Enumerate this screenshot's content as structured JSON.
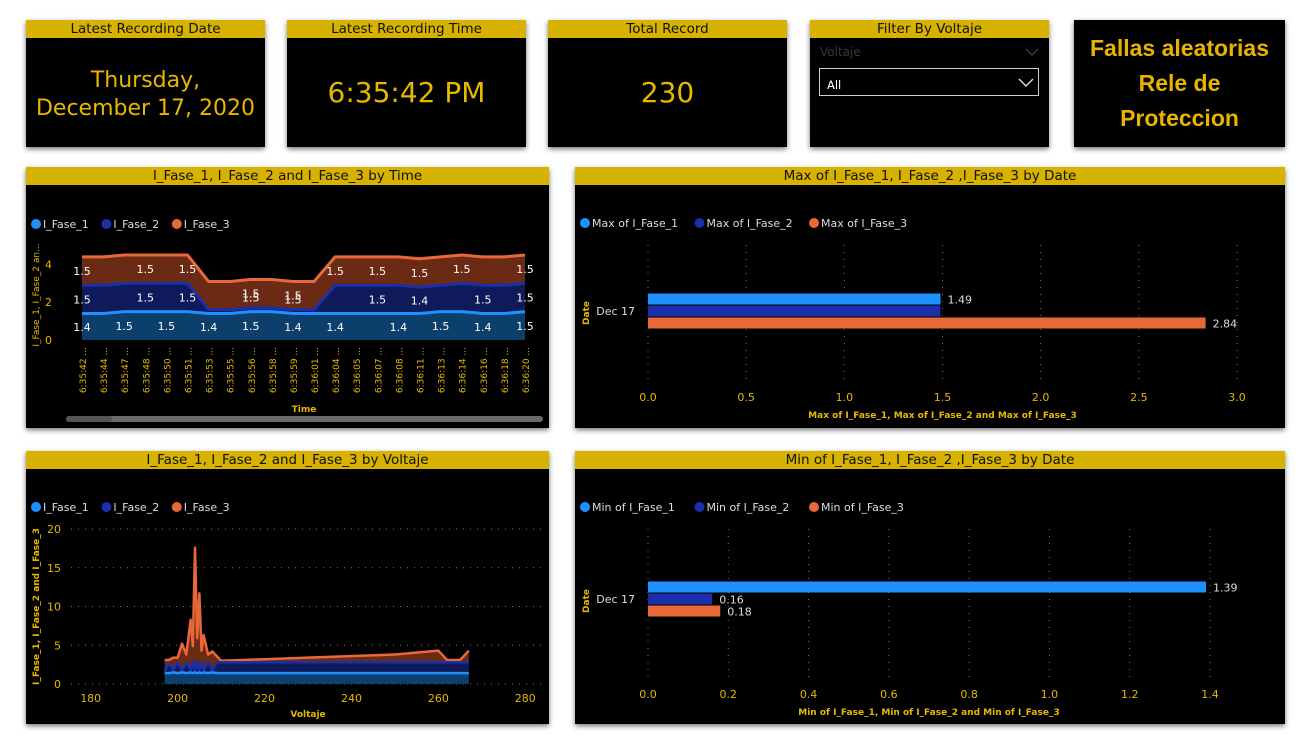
{
  "cards": {
    "date": {
      "title": "Latest Recording Date",
      "line1": "Thursday,",
      "line2": "December 17, 2020"
    },
    "time": {
      "title": "Latest Recording Time",
      "value": "6:35:42 PM"
    },
    "total": {
      "title": "Total Record",
      "value": "230"
    },
    "filter": {
      "title": "Filter By Voltaje",
      "label": "Voltaje",
      "selected": "All"
    },
    "brand": {
      "line1": "Fallas aleatorias",
      "line2": "Rele de",
      "line3": "Proteccion"
    }
  },
  "colors": {
    "header": "#d8b200",
    "accent": "#e6b800",
    "fase1": "#1e90ff",
    "fase2": "#1a2fa8",
    "fase3": "#e8683a",
    "band1": "#0c3f6b",
    "band2": "#0f1a5a",
    "band3": "#6b2a14"
  },
  "chart_data": [
    {
      "type": "area",
      "title": "I_Fase_1, I_Fase_2 and I_Fase_3 by Time",
      "xlabel": "Time",
      "ylabel": "I_Fase_1, I_Fase_2 an...",
      "legend": [
        "I_Fase_1",
        "I_Fase_2",
        "I_Fase_3"
      ],
      "legend_position": "top-left",
      "stacked": true,
      "grid": false,
      "ylim": [
        0,
        4.5
      ],
      "yticks": [
        0,
        2,
        4
      ],
      "x": [
        "6:35:42 ...",
        "6:35:44 ...",
        "6:35:47 ...",
        "6:35:48 ...",
        "6:35:50 ...",
        "6:35:51 ...",
        "6:35:53 ...",
        "6:35:55 ...",
        "6:35:56 ...",
        "6:35:58 ...",
        "6:35:59 ...",
        "6:36:01 ...",
        "6:36:04 ...",
        "6:36:05 ...",
        "6:36:07 ...",
        "6:36:08 ...",
        "6:36:11 ...",
        "6:36:13 ...",
        "6:36:14 ...",
        "6:36:16 ...",
        "6:36:18 ...",
        "6:36:20 ..."
      ],
      "series": [
        {
          "name": "I_Fase_1",
          "values": [
            1.4,
            1.4,
            1.5,
            1.5,
            1.5,
            1.5,
            1.4,
            1.4,
            1.5,
            1.5,
            1.4,
            1.4,
            1.4,
            1.4,
            1.4,
            1.4,
            1.4,
            1.5,
            1.5,
            1.4,
            1.4,
            1.5
          ]
        },
        {
          "name": "I_Fase_2",
          "values": [
            1.5,
            1.5,
            1.5,
            1.5,
            1.5,
            1.5,
            0.2,
            0.2,
            0.2,
            0.2,
            0.2,
            0.2,
            1.5,
            1.5,
            1.5,
            1.5,
            1.4,
            1.4,
            1.5,
            1.5,
            1.5,
            1.5
          ]
        },
        {
          "name": "I_Fase_3",
          "values": [
            1.5,
            1.5,
            1.5,
            1.5,
            1.5,
            1.5,
            1.5,
            1.5,
            1.5,
            1.5,
            1.5,
            1.5,
            1.5,
            1.5,
            1.5,
            1.5,
            1.5,
            1.5,
            1.5,
            1.5,
            1.5,
            1.5
          ]
        }
      ],
      "data_labels": [
        {
          "series": 2,
          "index": 0,
          "text": "1.5"
        },
        {
          "series": 2,
          "index": 3,
          "text": "1.5"
        },
        {
          "series": 2,
          "index": 5,
          "text": "1.5"
        },
        {
          "series": 2,
          "index": 8,
          "text": "1.5"
        },
        {
          "series": 2,
          "index": 10,
          "text": "1.5"
        },
        {
          "series": 2,
          "index": 12,
          "text": "1.5"
        },
        {
          "series": 2,
          "index": 14,
          "text": "1.5"
        },
        {
          "series": 2,
          "index": 16,
          "text": "1.5"
        },
        {
          "series": 2,
          "index": 18,
          "text": "1.5"
        },
        {
          "series": 2,
          "index": 21,
          "text": "1.5"
        },
        {
          "series": 1,
          "index": 0,
          "text": "1.5"
        },
        {
          "series": 1,
          "index": 3,
          "text": "1.5"
        },
        {
          "series": 1,
          "index": 5,
          "text": "1.5"
        },
        {
          "series": 1,
          "index": 14,
          "text": "1.5"
        },
        {
          "series": 1,
          "index": 16,
          "text": "1.4"
        },
        {
          "series": 1,
          "index": 19,
          "text": "1.5"
        },
        {
          "series": 1,
          "index": 21,
          "text": "1.5"
        },
        {
          "series": 0,
          "index": 0,
          "text": "1.4"
        },
        {
          "series": 0,
          "index": 2,
          "text": "1.5"
        },
        {
          "series": 0,
          "index": 4,
          "text": "1.5"
        },
        {
          "series": 0,
          "index": 6,
          "text": "1.4"
        },
        {
          "series": 0,
          "index": 8,
          "text": "1.5"
        },
        {
          "series": 0,
          "index": 10,
          "text": "1.4"
        },
        {
          "series": 0,
          "index": 12,
          "text": "1.4"
        },
        {
          "series": 0,
          "index": 15,
          "text": "1.4"
        },
        {
          "series": 0,
          "index": 17,
          "text": "1.5"
        },
        {
          "series": 0,
          "index": 19,
          "text": "1.4"
        },
        {
          "series": 0,
          "index": 21,
          "text": "1.5"
        }
      ],
      "mid_labels": [
        {
          "index": 8,
          "text": "1.5"
        },
        {
          "index": 10,
          "text": "1.5"
        }
      ]
    },
    {
      "type": "bar",
      "orientation": "horizontal",
      "title": "Max of I_Fase_1, I_Fase_2 ,I_Fase_3 by Date",
      "xlabel": "Max of I_Fase_1, Max of I_Fase_2 and Max of I_Fase_3",
      "ylabel": "Date",
      "legend": [
        "Max of I_Fase_1",
        "Max of I_Fase_2",
        "Max of I_Fase_3"
      ],
      "legend_position": "top-left",
      "categories": [
        "Dec 17"
      ],
      "xlim": [
        0,
        3.0
      ],
      "xticks": [
        "0.0",
        "0.5",
        "1.0",
        "1.5",
        "2.0",
        "2.5",
        "3.0"
      ],
      "series": [
        {
          "name": "Max of I_Fase_1",
          "values": [
            1.49
          ],
          "label": "1.49"
        },
        {
          "name": "Max of I_Fase_2",
          "values": [
            1.49
          ],
          "label": ""
        },
        {
          "name": "Max of I_Fase_3",
          "values": [
            2.84
          ],
          "label": "2.84"
        }
      ]
    },
    {
      "type": "area",
      "title": "I_Fase_1, I_Fase_2 and I_Fase_3 by Voltaje",
      "xlabel": "Voltaje",
      "ylabel": "I_Fase_1, I_Fase_2 and I_Fase_3",
      "legend": [
        "I_Fase_1",
        "I_Fase_2",
        "I_Fase_3"
      ],
      "legend_position": "top-left",
      "stacked": true,
      "xlim": [
        178,
        282
      ],
      "xticks": [
        180,
        200,
        220,
        240,
        260,
        280
      ],
      "ylim": [
        0,
        20
      ],
      "yticks": [
        0,
        5,
        10,
        15,
        20
      ],
      "x": [
        197,
        198,
        199,
        200,
        201,
        202,
        203,
        203.5,
        204,
        204.5,
        205,
        205.5,
        206,
        207,
        208,
        209,
        210,
        215,
        230,
        250,
        260,
        262,
        263,
        265,
        267
      ],
      "series": [
        {
          "name": "I_Fase_1",
          "values": [
            1.4,
            1.4,
            1.5,
            1.4,
            1.5,
            1.4,
            1.5,
            1.4,
            1.5,
            1.4,
            1.5,
            1.4,
            1.5,
            1.4,
            1.5,
            1.4,
            1.4,
            1.4,
            1.4,
            1.4,
            1.4,
            1.4,
            1.4,
            1.4,
            1.4
          ]
        },
        {
          "name": "I_Fase_2",
          "values": [
            0.2,
            1.3,
            0.3,
            1.4,
            0.2,
            1.4,
            0.3,
            1.5,
            0.2,
            1.5,
            0.2,
            1.4,
            0.3,
            1.4,
            0.2,
            1.4,
            1.4,
            1.4,
            1.4,
            1.4,
            1.4,
            1.4,
            1.4,
            1.4,
            1.4
          ]
        },
        {
          "name": "I_Fase_3",
          "values": [
            1.5,
            0.4,
            1.6,
            0.6,
            3.5,
            1.0,
            6.5,
            2.0,
            15.9,
            3.0,
            10.0,
            1.5,
            4.5,
            1.0,
            2.5,
            0.8,
            0.2,
            0.3,
            0.6,
            1.0,
            1.5,
            0.3,
            0.3,
            0.3,
            1.5
          ]
        }
      ]
    },
    {
      "type": "bar",
      "orientation": "horizontal",
      "title": "Min of I_Fase_1, I_Fase_2 ,I_Fase_3 by Date",
      "xlabel": "Min of I_Fase_1, Min of I_Fase_2 and Min of I_Fase_3",
      "ylabel": "Date",
      "legend": [
        "Min of I_Fase_1",
        "Min of I_Fase_2",
        "Min of I_Fase_3"
      ],
      "legend_position": "top-left",
      "categories": [
        "Dec 17"
      ],
      "xlim": [
        0,
        1.4
      ],
      "xticks": [
        "0.0",
        "0.2",
        "0.4",
        "0.6",
        "0.8",
        "1.0",
        "1.2",
        "1.4"
      ],
      "series": [
        {
          "name": "Min of I_Fase_1",
          "values": [
            1.39
          ],
          "label": "1.39"
        },
        {
          "name": "Min of I_Fase_2",
          "values": [
            0.16
          ],
          "label": "0.16"
        },
        {
          "name": "Min of I_Fase_3",
          "values": [
            0.18
          ],
          "label": "0.18"
        }
      ]
    }
  ]
}
